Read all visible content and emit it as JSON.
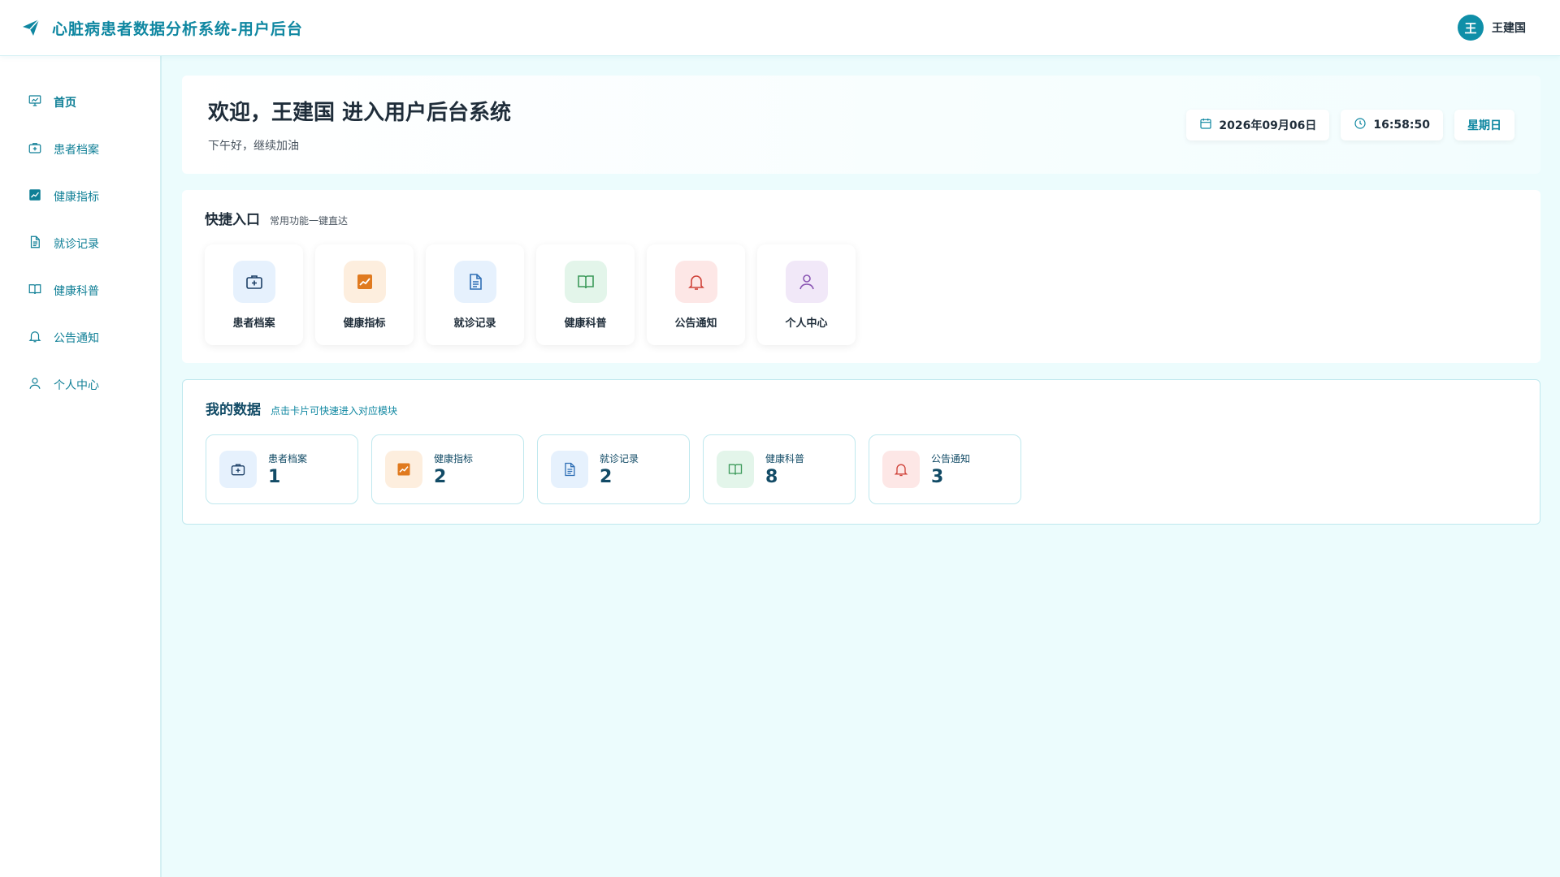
{
  "header": {
    "title": "心脏病患者数据分析系统-用户后台",
    "avatar_text": "王",
    "username": "王建国"
  },
  "sidebar": {
    "items": [
      {
        "label": "首页",
        "icon": "presentation-icon",
        "active": true
      },
      {
        "label": "患者档案",
        "icon": "medical-case-icon"
      },
      {
        "label": "健康指标",
        "icon": "chart-icon"
      },
      {
        "label": "就诊记录",
        "icon": "document-icon"
      },
      {
        "label": "健康科普",
        "icon": "book-icon"
      },
      {
        "label": "公告通知",
        "icon": "bell-icon"
      },
      {
        "label": "个人中心",
        "icon": "user-icon"
      }
    ]
  },
  "welcome": {
    "title": "欢迎，王建国 进入用户后台系统",
    "subtitle": "下午好，继续加油",
    "date": "2026年09月06日",
    "time": "16:58:50",
    "weekday": "星期日"
  },
  "quick": {
    "title": "快捷入口",
    "subtitle": "常用功能一键直达",
    "items": [
      {
        "label": "患者档案",
        "icon": "medical-case-icon",
        "bg": "#e6f1fd",
        "color": "#1c3f66"
      },
      {
        "label": "健康指标",
        "icon": "chart-icon",
        "bg": "#fdeede",
        "color": "#e07a1f"
      },
      {
        "label": "就诊记录",
        "icon": "document-icon",
        "bg": "#e6f1fd",
        "color": "#2f6fb5"
      },
      {
        "label": "健康科普",
        "icon": "book-icon",
        "bg": "#e3f5ea",
        "color": "#3c9a5a"
      },
      {
        "label": "公告通知",
        "icon": "bell-icon",
        "bg": "#fde7e6",
        "color": "#d0433a"
      },
      {
        "label": "个人中心",
        "icon": "user-icon",
        "bg": "#f1e8f8",
        "color": "#8a55b3"
      }
    ]
  },
  "mydata": {
    "title": "我的数据",
    "subtitle": "点击卡片可快速进入对应模块",
    "items": [
      {
        "label": "患者档案",
        "value": "1",
        "icon": "medical-case-icon"
      },
      {
        "label": "健康指标",
        "value": "2",
        "icon": "chart-icon"
      },
      {
        "label": "就诊记录",
        "value": "2",
        "icon": "document-icon"
      },
      {
        "label": "健康科普",
        "value": "8",
        "icon": "book-icon"
      },
      {
        "label": "公告通知",
        "value": "3",
        "icon": "bell-icon"
      }
    ]
  },
  "colors": {
    "accent": "#0f87a1",
    "background": "#ecfcfd"
  }
}
